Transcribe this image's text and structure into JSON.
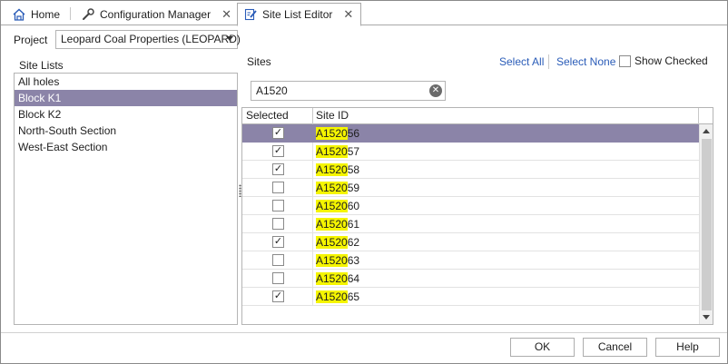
{
  "tabs": [
    {
      "label": "Home",
      "icon": "home-icon",
      "closable": false
    },
    {
      "label": "Configuration Manager",
      "icon": "wrench-icon",
      "closable": true
    },
    {
      "label": "Site List Editor",
      "icon": "edit-document-icon",
      "closable": true,
      "active": true
    }
  ],
  "project": {
    "label": "Project",
    "selected": "Leopard Coal Properties (LEOPARD)"
  },
  "site_lists": {
    "label": "Site Lists",
    "items": [
      "All holes",
      "Block K1",
      "Block K2",
      "North-South Section",
      "West-East Section"
    ],
    "selected": "Block K1"
  },
  "sites": {
    "label": "Sites",
    "select_all": "Select All",
    "select_none": "Select None",
    "show_checked": "Show Checked",
    "show_checked_value": false,
    "search_value": "A1520",
    "columns": [
      "Selected",
      "Site ID"
    ],
    "rows": [
      {
        "match": "A1520",
        "rest": "56",
        "checked": true,
        "selected": true
      },
      {
        "match": "A1520",
        "rest": "57",
        "checked": true,
        "selected": false
      },
      {
        "match": "A1520",
        "rest": "58",
        "checked": true,
        "selected": false
      },
      {
        "match": "A1520",
        "rest": "59",
        "checked": false,
        "selected": false
      },
      {
        "match": "A1520",
        "rest": "60",
        "checked": false,
        "selected": false
      },
      {
        "match": "A1520",
        "rest": "61",
        "checked": false,
        "selected": false
      },
      {
        "match": "A1520",
        "rest": "62",
        "checked": true,
        "selected": false
      },
      {
        "match": "A1520",
        "rest": "63",
        "checked": false,
        "selected": false
      },
      {
        "match": "A1520",
        "rest": "64",
        "checked": false,
        "selected": false
      },
      {
        "match": "A1520",
        "rest": "65",
        "checked": true,
        "selected": false
      }
    ]
  },
  "buttons": {
    "ok": "OK",
    "cancel": "Cancel",
    "help": "Help"
  },
  "colors": {
    "selection": "#8b84a8",
    "highlight": "#f5f500",
    "link": "#2a5cb8"
  }
}
